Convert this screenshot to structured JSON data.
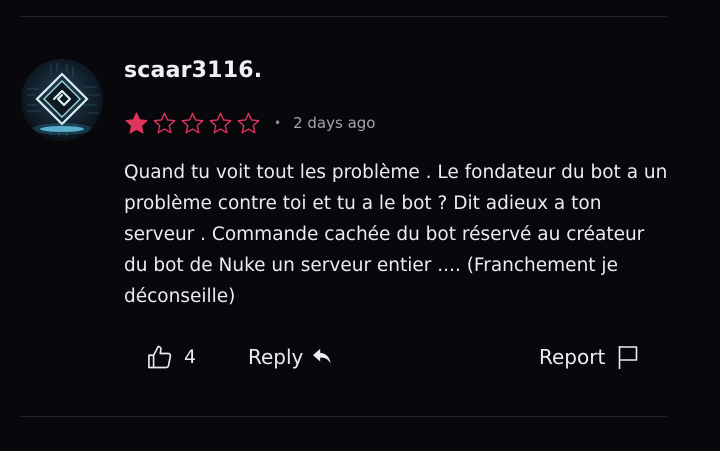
{
  "review": {
    "username": "scaar3116.",
    "rating": {
      "value": 1,
      "max": 5,
      "active_color": "#e0345c",
      "inactive_color": "#e0345c"
    },
    "separator": "•",
    "time_ago": "2 days ago",
    "comment": "Quand tu voit tout les problème . Le fondateur du bot a un problème contre toi et tu a le bot ? Dit adieux a ton serveur . Commande cachée du bot réservé au créateur du bot de Nuke un serveur entier .... (Franchement je déconseille)",
    "avatar_icon": "geometric-logo-icon"
  },
  "actions": {
    "like_icon": "thumbs-up-icon",
    "like_count": "4",
    "reply_label": "Reply",
    "reply_icon": "reply-arrow-icon",
    "report_label": "Report",
    "report_icon": "flag-icon"
  }
}
